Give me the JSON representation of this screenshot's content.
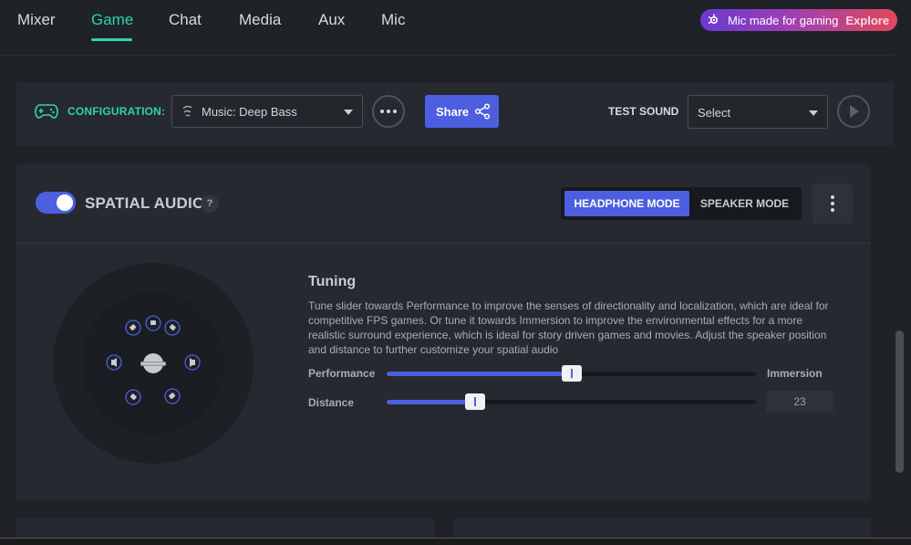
{
  "nav": {
    "tabs": [
      {
        "label": "Mixer"
      },
      {
        "label": "Game"
      },
      {
        "label": "Chat"
      },
      {
        "label": "Media"
      },
      {
        "label": "Aux"
      },
      {
        "label": "Mic"
      }
    ],
    "active_tab": "Game",
    "promo": {
      "text": "Mic made for gaming",
      "cta": "Explore",
      "icon": "steelseries-logo-icon"
    }
  },
  "config": {
    "label": "CONFIGURATION:",
    "selected": "Music: Deep Bass",
    "share_label": "Share",
    "test_sound_label": "TEST SOUND",
    "test_sound_value": "Select"
  },
  "spatial": {
    "title": "SPATIAL AUDIO",
    "help": "?",
    "enabled": true,
    "modes": {
      "headphone": "HEADPHONE MODE",
      "speaker": "SPEAKER MODE"
    },
    "active_mode": "HEADPHONE MODE",
    "tuning": {
      "title": "Tuning",
      "description": "Tune slider towards Performance to improve the senses of directionality and localization, which are ideal for competitive FPS games. Or tune it towards Immersion to improve the environmental effects for a more realistic surround experience, which is ideal for story driven games and movies. Adjust the speaker position and distance to further customize your spatial audio",
      "performance_label": "Performance",
      "immersion_label": "Immersion",
      "performance_level": 0.5,
      "distance_label": "Distance",
      "distance_value": "23",
      "distance_level": 0.24
    }
  },
  "colors": {
    "accent_green": "#2fd4a7",
    "accent_blue": "#4c5fe0",
    "panel": "#262a30",
    "background": "#1f2328"
  }
}
